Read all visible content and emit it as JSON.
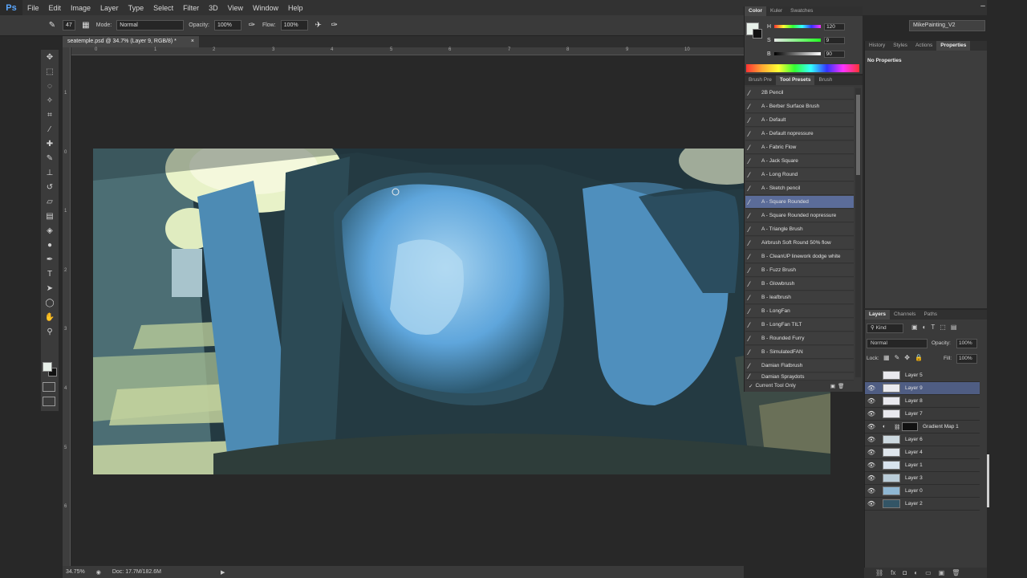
{
  "app": {
    "logo": "Ps",
    "menu": [
      "File",
      "Edit",
      "Image",
      "Layer",
      "Type",
      "Select",
      "Filter",
      "3D",
      "View",
      "Window",
      "Help"
    ],
    "workspace": "MikePainting_V2"
  },
  "options": {
    "brush_size": "47",
    "mode_label": "Mode:",
    "mode_value": "Normal",
    "opacity_label": "Opacity:",
    "opacity_value": "100%",
    "flow_label": "Flow:",
    "flow_value": "100%"
  },
  "document": {
    "tab_title": "seatemple.psd @ 34.7% (Layer 9, RGB/8) *",
    "zoom": "34.75%",
    "doc_info": "Doc: 17.7M/182.6M",
    "ruler_h": [
      "0",
      "1",
      "2",
      "3",
      "4",
      "5",
      "6",
      "7",
      "8",
      "9",
      "10"
    ],
    "ruler_v": [
      "1",
      "0",
      "1",
      "2",
      "3",
      "4",
      "5",
      "6"
    ]
  },
  "color_panel": {
    "tabs": [
      "Color",
      "Kuler",
      "Swatches"
    ],
    "h_label": "H",
    "h_value": "120",
    "s_label": "S",
    "s_value": "9",
    "b_label": "B",
    "b_value": "90",
    "unit": "%",
    "fg_color": "#e8f0ea"
  },
  "presets_panel": {
    "tabs": [
      "Brush Pre",
      "Tool Presets",
      "Brush"
    ],
    "items": [
      "2B Pencil",
      "A - Berber Surface Brush",
      "A - Default",
      "A - Default nopressure",
      "A - Fabric Flow",
      "A - Jack Square",
      "A - Long Round",
      "A - Sketch pencil",
      "A - Square Rounded",
      "A - Square Rounded nopressure",
      "A - Triangle Brush",
      "Airbrush Soft Round 50% flow",
      "B - CleanUP linework dodge white",
      "B - Fuzz Brush",
      "B - Glowbrush",
      "B - leafbrush",
      "B - LongFan",
      "B - LongFan TILT",
      "B - Rounded Furry",
      "B - SimulatedFAN",
      "Damian Flatbrush",
      "Damian Spraydots"
    ],
    "selected": "A - Square Rounded",
    "current_tool_only": "Current Tool Only"
  },
  "properties_panel": {
    "tabs": [
      "History",
      "Styles",
      "Actions",
      "Properties"
    ],
    "message": "No Properties"
  },
  "layers_panel": {
    "tabs": [
      "Layers",
      "Channels",
      "Paths"
    ],
    "kind": "Kind",
    "blend": "Normal",
    "opacity_label": "Opacity:",
    "opacity_value": "100%",
    "lock_label": "Lock:",
    "fill_label": "Fill:",
    "fill_value": "100%",
    "layers": [
      "Layer 5",
      "Layer 9",
      "Layer 8",
      "Layer 7",
      "Gradient Map 1",
      "Layer 6",
      "Layer 4",
      "Layer 1",
      "Layer 3",
      "Layer 0",
      "Layer 2"
    ],
    "selected": "Layer 9"
  }
}
